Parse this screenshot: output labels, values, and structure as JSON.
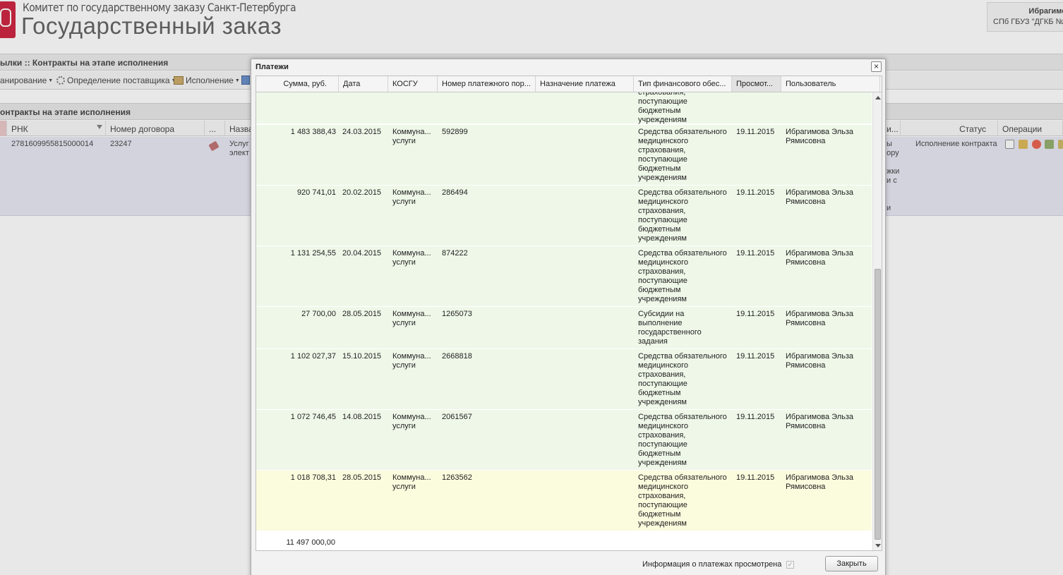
{
  "app": {
    "org_name": "Комитет по государственному заказу Санкт-Петербурга",
    "title": "Государственный заказ",
    "user_name": "Ибрагимо",
    "user_org": "СПб ГБУЗ \"ДГКБ №"
  },
  "breadcrumb": "ылки :: Контракты на этапе исполнения",
  "menu": {
    "planning": "анирование",
    "supplier": "Определение поставщика",
    "execution": "Исполнение"
  },
  "panel_title": "онтракты на этапе исполнения",
  "contracts_grid": {
    "columns": [
      "РНК",
      "Номер договора",
      "...",
      "Назва",
      "и...",
      "Статус",
      "Операции"
    ],
    "row": {
      "rnk": "2781609955815000014",
      "contract_number": "23247",
      "name_fragment_1": "Услуг",
      "name_fragment_2": "элект",
      "side_fragment_1": "ы",
      "side_fragment_2": "ору",
      "side_fragment_3": "жки",
      "side_fragment_4": "и с",
      "side_fragment_5": "и",
      "status": "Исполнение контракта"
    }
  },
  "modal": {
    "title": "Платежи",
    "close_glyph": "×",
    "columns": {
      "sum": "Сумма, руб.",
      "date": "Дата",
      "kosgu": "КОСГУ",
      "number": "Номер платежного пор...",
      "purpose": "Назначение платежа",
      "financing_type": "Тип финансового обес...",
      "viewed": "Просмот...",
      "user": "Пользователь"
    },
    "partial_row": {
      "financing_type": "страхования,\nпоступающие\nбюджетным\nучреждениям"
    },
    "rows": [
      {
        "sum": "1 483 388,43",
        "date": "24.03.2015",
        "kosgu": "Коммуна...\nуслуги",
        "number": "592899",
        "purpose": "",
        "financing_type": "Средства обязательного\nмедицинского\nстрахования,\nпоступающие\nбюджетным\nучреждениям",
        "viewed": "19.11.2015",
        "user": "Ибрагимова Эльза\nРямисовна"
      },
      {
        "sum": "920 741,01",
        "date": "20.02.2015",
        "kosgu": "Коммуна...\nуслуги",
        "number": "286494",
        "purpose": "",
        "financing_type": "Средства обязательного\nмедицинского\nстрахования,\nпоступающие\nбюджетным\nучреждениям",
        "viewed": "19.11.2015",
        "user": "Ибрагимова Эльза\nРямисовна"
      },
      {
        "sum": "1 131 254,55",
        "date": "20.04.2015",
        "kosgu": "Коммуна...\nуслуги",
        "number": "874222",
        "purpose": "",
        "financing_type": "Средства обязательного\nмедицинского\nстрахования,\nпоступающие\nбюджетным\nучреждениям",
        "viewed": "19.11.2015",
        "user": "Ибрагимова Эльза\nРямисовна"
      },
      {
        "sum": "27 700,00",
        "date": "28.05.2015",
        "kosgu": "Коммуна...\nуслуги",
        "number": "1265073",
        "purpose": "",
        "financing_type": "Субсидии на\nвыполнение\nгосударственного\nзадания",
        "viewed": "19.11.2015",
        "user": "Ибрагимова Эльза\nРямисовна"
      },
      {
        "sum": "1 102 027,37",
        "date": "15.10.2015",
        "kosgu": "Коммуна...\nуслуги",
        "number": "2668818",
        "purpose": "",
        "financing_type": "Средства обязательного\nмедицинского\nстрахования,\nпоступающие\nбюджетным\nучреждениям",
        "viewed": "19.11.2015",
        "user": "Ибрагимова Эльза\nРямисовна"
      },
      {
        "sum": "1 072 746,45",
        "date": "14.08.2015",
        "kosgu": "Коммуна...\nуслуги",
        "number": "2061567",
        "purpose": "",
        "financing_type": "Средства обязательного\nмедицинского\nстрахования,\nпоступающие\nбюджетным\nучреждениям",
        "viewed": "19.11.2015",
        "user": "Ибрагимова Эльза\nРямисовна"
      },
      {
        "sum": "1 018 708,31",
        "date": "28.05.2015",
        "kosgu": "Коммуна...\nуслуги",
        "number": "1263562",
        "purpose": "",
        "financing_type": "Средства обязательного\nмедицинского\nстрахования,\nпоступающие\nбюджетным\nучреждениям",
        "viewed": "19.11.2015",
        "user": "Ибрагимова Эльза\nРямисовна",
        "highlighted": true
      }
    ],
    "total": "11 497 000,00",
    "viewed_label": "Информация о платежах просмотрена",
    "viewed_checked": true,
    "close_button": "Закрыть"
  }
}
